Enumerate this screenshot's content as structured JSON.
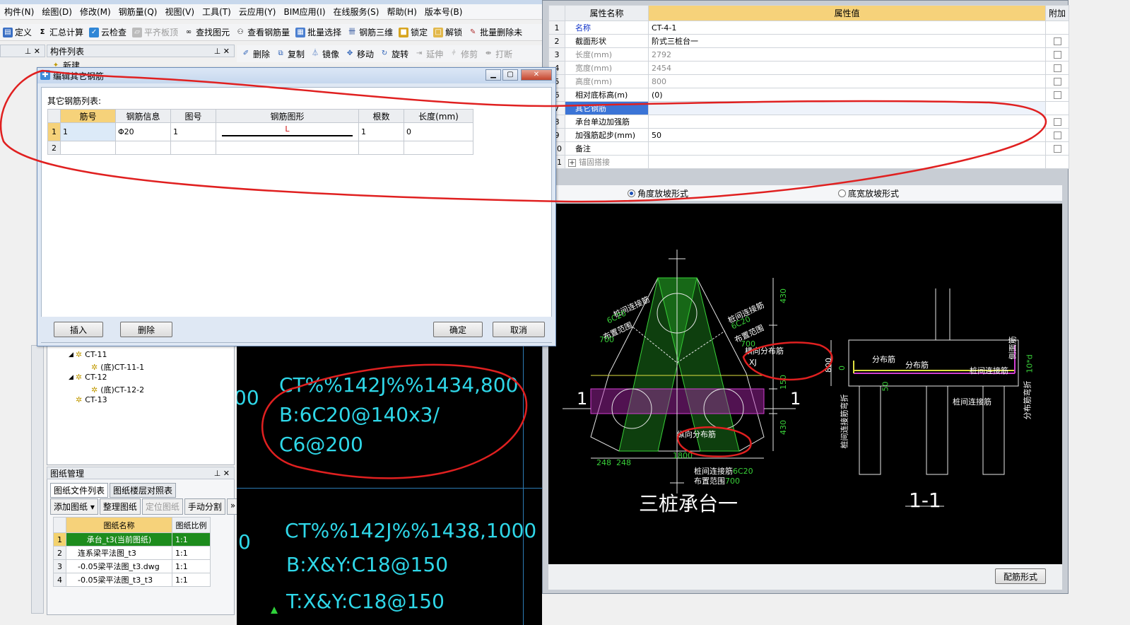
{
  "menu": [
    "构件(N)",
    "绘图(D)",
    "修改(M)",
    "钢筋量(Q)",
    "视图(V)",
    "工具(T)",
    "云应用(Y)",
    "BIM应用(I)",
    "在线服务(S)",
    "帮助(H)",
    "版本号(B)"
  ],
  "toolbar": {
    "define": "定义",
    "summary": "汇总计算",
    "cloud_check": "云检查",
    "level_slab": "平齐板顶",
    "find_element": "查找图元",
    "view_rebar": "查看钢筋量",
    "batch_select": "批量选择",
    "rebar_3d": "钢筋三维",
    "lock": "锁定",
    "unlock": "解锁",
    "batch_delete": "批量删除未"
  },
  "component_list": {
    "title": "构件列表",
    "new_label": "新建"
  },
  "edit_toolbar": {
    "delete": "删除",
    "copy": "复制",
    "mirror": "镜像",
    "move": "移动",
    "rotate": "旋转",
    "extend": "延伸",
    "trim": "修剪",
    "break": "打断"
  },
  "dialog": {
    "title": "编辑其它钢筋",
    "list_label": "其它钢筋列表:",
    "columns": [
      "筋号",
      "钢筋信息",
      "图号",
      "钢筋图形",
      "根数",
      "长度(mm)"
    ],
    "rows": [
      {
        "num": "1",
        "bar_no": "1",
        "info": "Φ20",
        "fig_no": "1",
        "shape_label": "L",
        "count": "1",
        "length": "0"
      },
      {
        "num": "2"
      }
    ],
    "insert": "插入",
    "delete": "删除",
    "ok": "确定",
    "cancel": "取消"
  },
  "tree": [
    {
      "label": "CT-11",
      "level": 1
    },
    {
      "label": "(底)CT-11-1",
      "level": 2
    },
    {
      "label": "CT-12",
      "level": 1
    },
    {
      "label": "(底)CT-12-2",
      "level": 2
    },
    {
      "label": "CT-13",
      "level": 1
    }
  ],
  "drawing_mgmt": {
    "title": "图纸管理",
    "tabs": [
      "图纸文件列表",
      "图纸楼层对照表"
    ],
    "buttons": [
      "添加图纸",
      "整理图纸",
      "定位图纸",
      "手动分割"
    ],
    "more": "»",
    "columns": [
      "图纸名称",
      "图纸比例"
    ],
    "rows": [
      {
        "num": "1",
        "name": "承台_t3(当前图纸)",
        "scale": "1:1"
      },
      {
        "num": "2",
        "name": "连系梁平法图_t3",
        "scale": "1:1"
      },
      {
        "num": "3",
        "name": "-0.05梁平法图_t3.dwg",
        "scale": "1:1"
      },
      {
        "num": "4",
        "name": "-0.05梁平法图_t3_t3",
        "scale": "1:1"
      }
    ]
  },
  "cad_text": {
    "block1": [
      "CT%%142J%%1434,800",
      "B:6C20@140x3/",
      "C6@200"
    ],
    "block2": [
      "CT%%142J%%1438,1000",
      "B:X&Y:C18@150",
      "T:X&Y:C18@150"
    ],
    "edge1": "00",
    "edge2": "0"
  },
  "properties": {
    "columns": [
      "属性名称",
      "属性值",
      "附加"
    ],
    "rows": [
      {
        "num": "1",
        "name": "名称",
        "value": "CT-4-1",
        "style": "blue",
        "check": false
      },
      {
        "num": "2",
        "name": "截面形状",
        "value": "阶式三桩台一",
        "style": "",
        "check": true
      },
      {
        "num": "3",
        "name": "长度(mm)",
        "value": "2792",
        "style": "gray",
        "check": true
      },
      {
        "num": "4",
        "name": "宽度(mm)",
        "value": "2454",
        "style": "gray",
        "check": true
      },
      {
        "num": "5",
        "name": "高度(mm)",
        "value": "800",
        "style": "gray",
        "check": true
      },
      {
        "num": "6",
        "name": "相对底标高(m)",
        "value": "(0)",
        "style": "",
        "check": true
      },
      {
        "num": "7",
        "name": "其它钢筋",
        "value": "",
        "style": "sel",
        "check": false
      },
      {
        "num": "8",
        "name": "承台单边加强筋",
        "value": "",
        "style": "",
        "check": true
      },
      {
        "num": "9",
        "name": "加强筋起步(mm)",
        "value": "50",
        "style": "",
        "check": true
      },
      {
        "num": "10",
        "name": "备注",
        "value": "",
        "style": "",
        "check": true
      },
      {
        "num": "11",
        "name": "锚固搭接",
        "value": "",
        "style": "gray",
        "check": false
      }
    ],
    "expand": "+"
  },
  "radio": {
    "angle": "角度放坡形式",
    "bottom_width": "底宽放坡形式"
  },
  "drawing_labels": {
    "title_left": "三桩承台一",
    "title_right": "1-1",
    "section_mark": "1",
    "pile_conn_1": "桩间连接筋",
    "pile_conn_1b": "6C20",
    "pile_conn_1c": "布置范围",
    "pile_conn_1d": "700",
    "pile_conn_2": "桩间连接筋",
    "pile_conn_2b": "6C20",
    "pile_conn_2c": "布置范围",
    "pile_conn_2d": "700",
    "transverse": "横向分布筋",
    "longitudinal": "纵向分布筋",
    "xj": "XJ",
    "dim_430a": "430",
    "dim_430b": "430",
    "dim_150": "150",
    "dim_1800": "1800",
    "dim_248a": "248",
    "dim_248b": "248",
    "bottom_conn": "桩间连接筋",
    "bottom_conn_b": "6C20",
    "bottom_range": "布置范围",
    "bottom_range_b": "700",
    "dim_800": "800",
    "dim_0": "0",
    "dim_50": "50",
    "dist1": "分布筋",
    "dist2": "分布筋",
    "side_face": "侧面筋",
    "side_conn": "桩间连接筋",
    "side_bottom": "桩间连接筋",
    "pile_bend": "桩间连接筋弯折",
    "dist_bend": "分布筋弯折",
    "ten_d": "10*d"
  },
  "rebar_form_button": "配筋形式"
}
